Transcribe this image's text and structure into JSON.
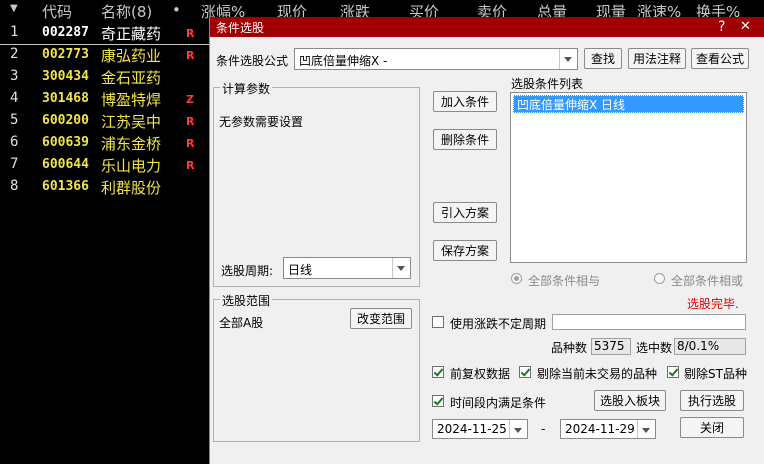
{
  "table": {
    "columns": [
      "代码",
      "名称(8)",
      "•",
      "涨幅%",
      "现价",
      "涨跌",
      "买价",
      "卖价",
      "总量",
      "现量",
      "涨速%",
      "换手%"
    ],
    "rows": [
      {
        "index": "1",
        "code": "002287",
        "name": "奇正藏药",
        "flag": "R"
      },
      {
        "index": "2",
        "code": "002773",
        "name": "康弘药业",
        "flag": "R"
      },
      {
        "index": "3",
        "code": "300434",
        "name": "金石亚药",
        "flag": ""
      },
      {
        "index": "4",
        "code": "301468",
        "name": "博盈特焊",
        "flag": "Z"
      },
      {
        "index": "5",
        "code": "600200",
        "name": "江苏吴中",
        "flag": "R"
      },
      {
        "index": "6",
        "code": "600639",
        "name": "浦东金桥",
        "flag": "R"
      },
      {
        "index": "7",
        "code": "600644",
        "name": "乐山电力",
        "flag": "R"
      },
      {
        "index": "8",
        "code": "601366",
        "name": "利群股份",
        "flag": ""
      }
    ]
  },
  "dialog": {
    "title": "条件选股",
    "help_glyph": "?",
    "close_glyph": "✕",
    "formula_label": "条件选股公式",
    "formula_value": "凹底倍量伸缩X -",
    "buttons": {
      "search": "查找",
      "usage_note": "用法注释",
      "view_formula": "查看公式",
      "add_condition": "加入条件",
      "delete_condition": "删除条件",
      "import_plan": "引入方案",
      "save_plan": "保存方案",
      "change_range": "改变范围",
      "to_block": "选股入板块",
      "execute": "执行选股",
      "close": "关闭"
    },
    "params_group_title": "计算参数",
    "params_message": "无参数需要设置",
    "period_label": "选股周期:",
    "period_value": "日线",
    "conditions_list_label": "选股条件列表",
    "conditions": [
      "凹底倍量伸缩X  日线"
    ],
    "radio_and": "全部条件相与",
    "radio_or": "全部条件相或",
    "status": "选股完毕.",
    "range_group_title": "选股范围",
    "range_value": "全部A股",
    "use_uncertain_period": "使用涨跌不定周期",
    "variety_count_label": "品种数",
    "variety_count": "5375",
    "selected_count_label": "选中数",
    "selected_count": "8/0.1%",
    "adjusted_data": "前复权数据",
    "exclude_untraded": "剔除当前未交易的品种",
    "exclude_st": "剔除ST品种",
    "time_range_label": "时间段内满足条件",
    "date_from": "2024-11-25",
    "date_separator": "-",
    "date_to": "2024-11-29"
  },
  "colors": {
    "title_bar": "#a00000",
    "code_text": "#f0e44a",
    "flag_text": "#ff3c3c",
    "status_text": "#e00000",
    "selection": "#3399ff"
  }
}
